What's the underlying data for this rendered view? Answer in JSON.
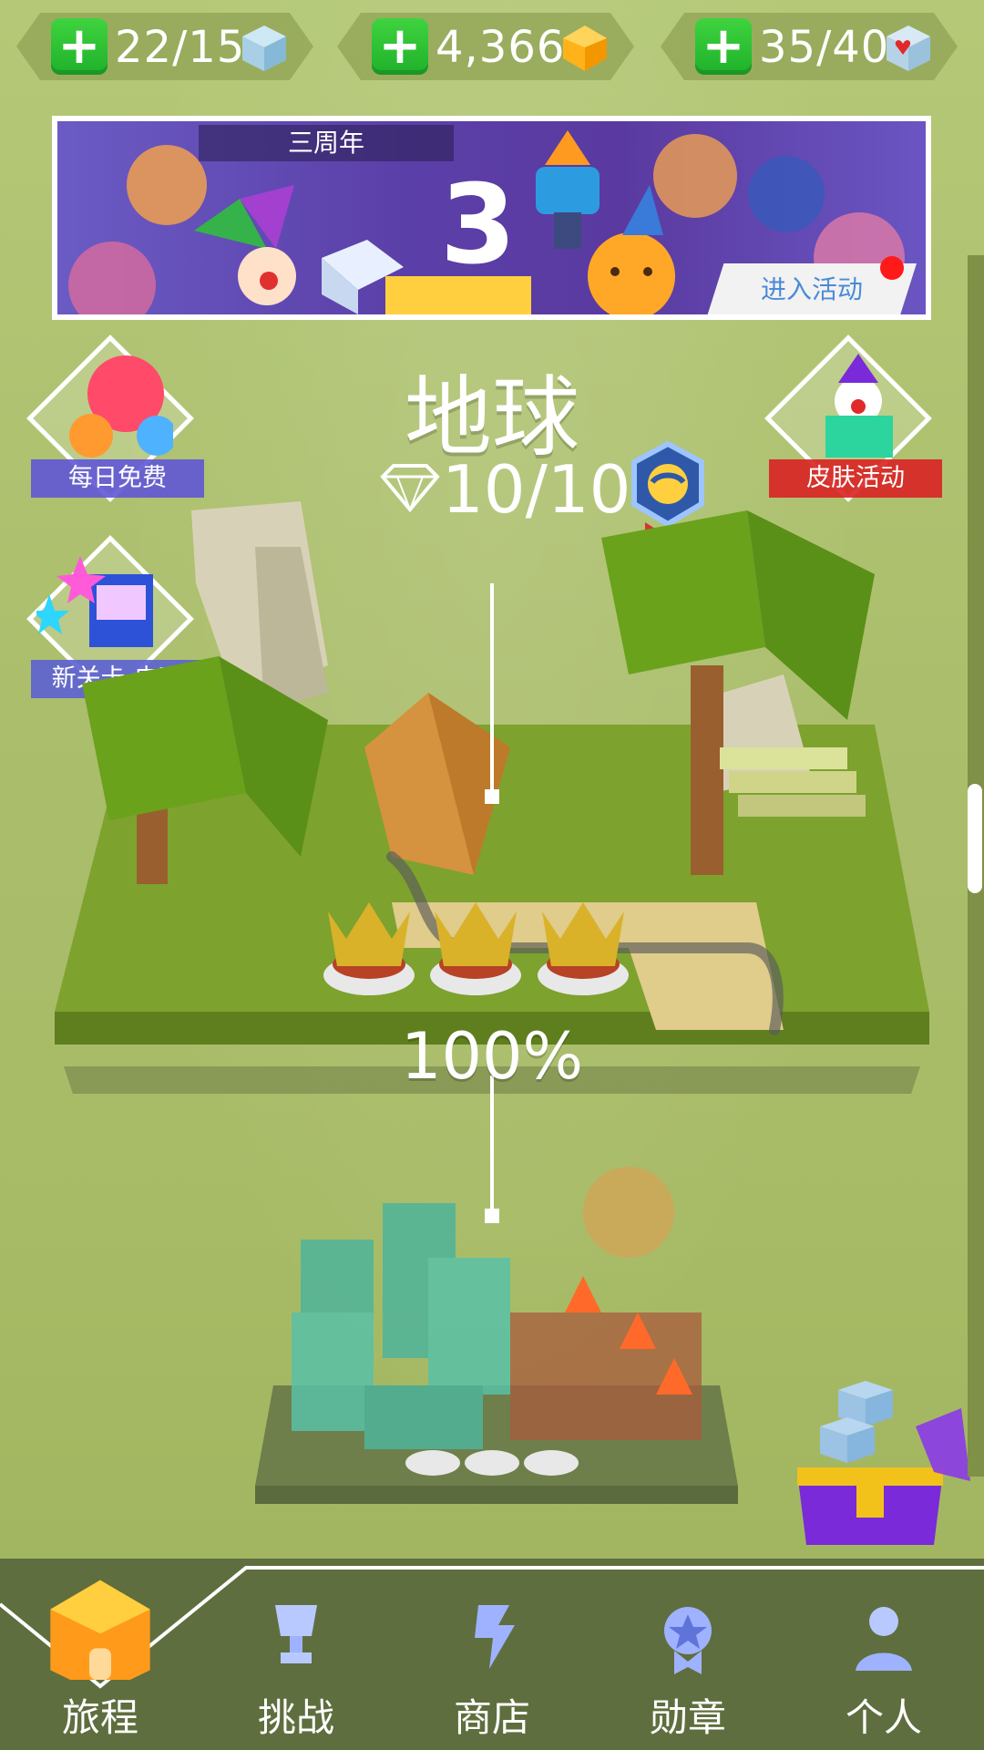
{
  "top_stats": [
    {
      "value": "22/15",
      "icon": "ice-cube-icon"
    },
    {
      "value": "4,366",
      "icon": "gold-gem-icon"
    },
    {
      "value": "35/40",
      "icon": "heart-cube-icon"
    }
  ],
  "banner": {
    "tag": "三周年",
    "button": "进入活动"
  },
  "side": {
    "daily_free": "每日免费",
    "new_level": "新关卡-电玩",
    "skin_event": "皮肤活动"
  },
  "world": {
    "name": "地球",
    "progress": "10/10",
    "percent": "100%"
  },
  "tabs": [
    "旅程",
    "挑战",
    "商店",
    "勋章",
    "个人"
  ],
  "colors": {
    "bg": "#a9bd6a",
    "green_plus": "#25b82d",
    "bar": "#5f6e3e"
  }
}
